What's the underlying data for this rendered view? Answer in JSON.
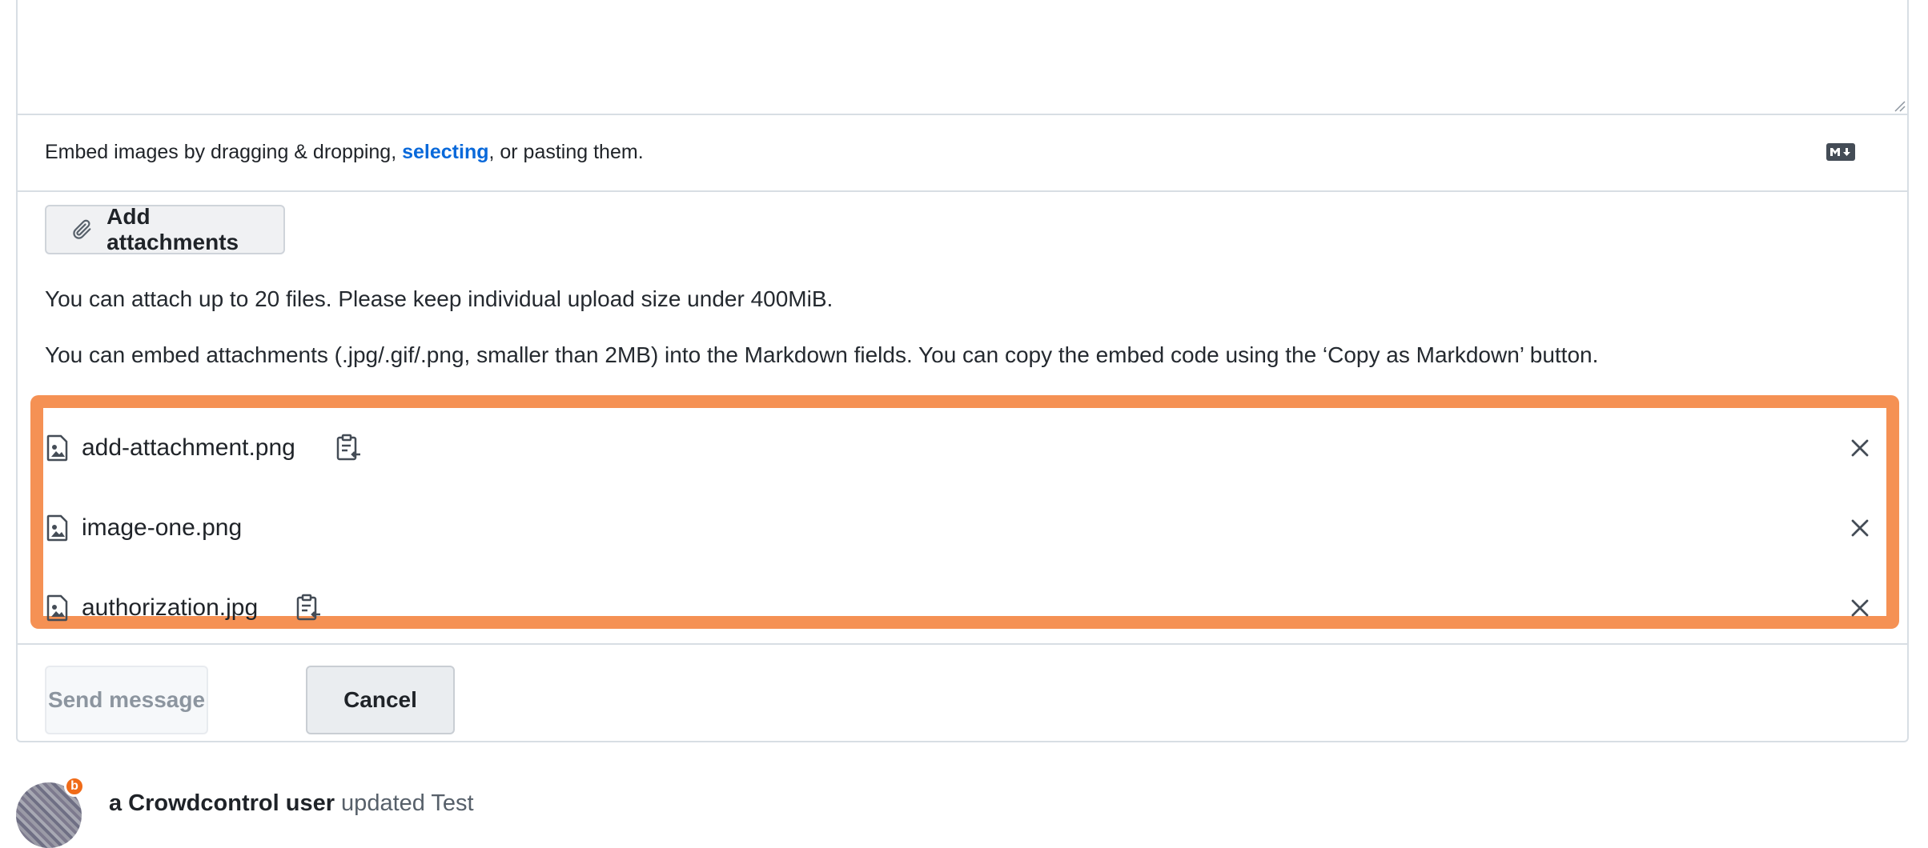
{
  "editor": {
    "embed_prefix": "Embed images by dragging & dropping, ",
    "embed_link": "selecting",
    "embed_suffix": ", or pasting them.",
    "markdown_icon": "markdown-icon"
  },
  "attachments": {
    "add_label": "Add attachments",
    "info_limit": "You can attach up to 20 files. Please keep individual upload size under 400MiB.",
    "info_embed": "You can embed attachments (.jpg/.gif/.png, smaller than 2MB) into the Markdown fields. You can copy the embed code using the ‘Copy as Markdown’ button.",
    "files": [
      {
        "name": "add-attachment.png",
        "copyable": true
      },
      {
        "name": "image-one.png",
        "copyable": false
      },
      {
        "name": "authorization.jpg",
        "copyable": true
      }
    ]
  },
  "actions": {
    "send_label": "Send message",
    "cancel_label": "Cancel"
  },
  "activity": {
    "user": "a Crowdcontrol user",
    "action": " updated Test",
    "badge": "b"
  },
  "colors": {
    "highlight": "#f59154",
    "link": "#0969da",
    "badge": "#f06b18"
  }
}
